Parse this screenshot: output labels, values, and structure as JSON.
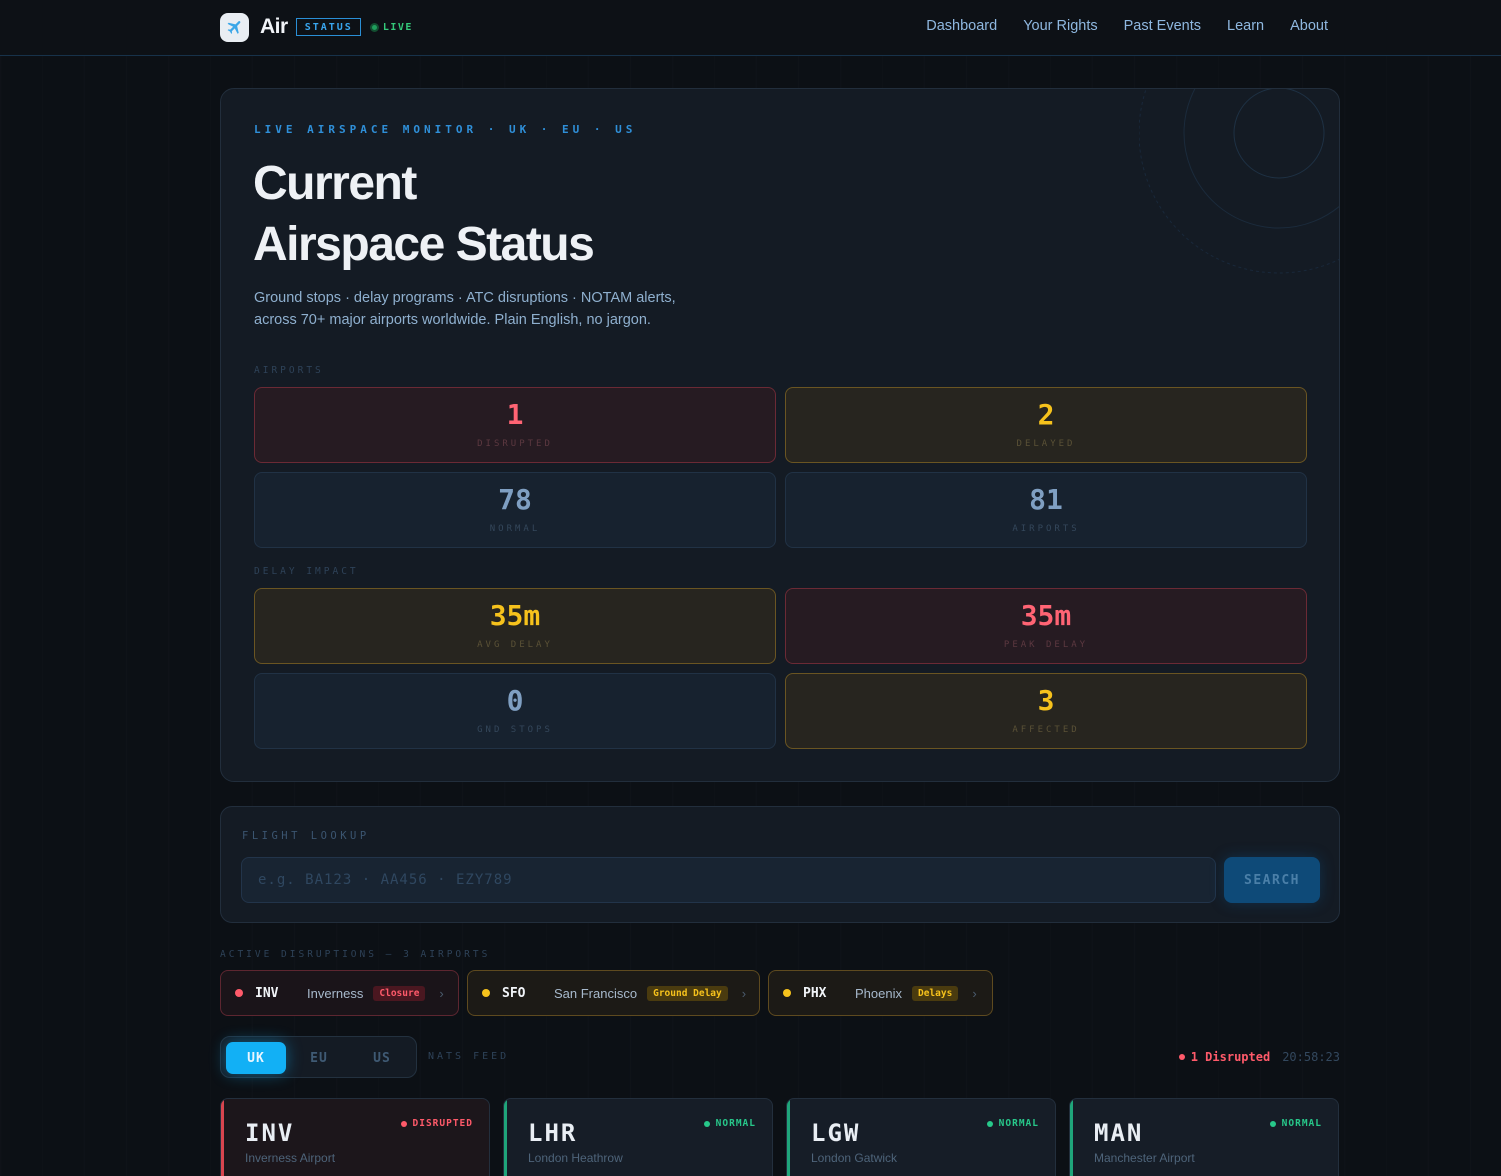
{
  "nav": {
    "brand": "Air",
    "status_tag": "STATUS",
    "live_label": "LIVE",
    "links": [
      "Dashboard",
      "Your Rights",
      "Past Events",
      "Learn",
      "About"
    ]
  },
  "hero": {
    "kicker": "LIVE AIRSPACE MONITOR · UK · EU · US",
    "title_line1": "Current",
    "title_line2": "Airspace Status",
    "subtitle": "Ground stops · delay programs · ATC disruptions · NOTAM alerts, across 70+ major airports worldwide. Plain English, no jargon.",
    "airports_label": "AIRPORTS",
    "airports": [
      {
        "value": "1",
        "label": "DISRUPTED",
        "tone": "red"
      },
      {
        "value": "2",
        "label": "DELAYED",
        "tone": "amber"
      },
      {
        "value": "78",
        "label": "NORMAL",
        "tone": "blue"
      },
      {
        "value": "81",
        "label": "AIRPORTS",
        "tone": "blue"
      }
    ],
    "delay_label": "DELAY IMPACT",
    "delay": [
      {
        "value": "35m",
        "label": "AVG DELAY",
        "tone": "amber"
      },
      {
        "value": "35m",
        "label": "PEAK DELAY",
        "tone": "red"
      },
      {
        "value": "0",
        "label": "GND STOPS",
        "tone": "blue"
      },
      {
        "value": "3",
        "label": "AFFECTED",
        "tone": "amber"
      }
    ]
  },
  "lookup": {
    "label": "FLIGHT LOOKUP",
    "placeholder": "e.g. BA123 · AA456 · EZY789",
    "value": "",
    "button": "SEARCH"
  },
  "disruptions": {
    "label": "ACTIVE DISRUPTIONS — 3 AIRPORTS",
    "items": [
      {
        "code": "INV",
        "city": "Inverness",
        "badge": "Closure",
        "tone": "red"
      },
      {
        "code": "SFO",
        "city": "San Francisco",
        "badge": "Ground Delay",
        "tone": "amber"
      },
      {
        "code": "PHX",
        "city": "Phoenix",
        "badge": "Delays",
        "tone": "amber"
      }
    ]
  },
  "regions": {
    "tabs": [
      "UK",
      "EU",
      "US"
    ],
    "active": "UK",
    "feed_label": "NATS FEED",
    "summary": "1 Disrupted",
    "time": "20:58:23"
  },
  "cards": [
    {
      "code": "INV",
      "name": "Inverness Airport",
      "status": "DISRUPTED",
      "tone": "red"
    },
    {
      "code": "LHR",
      "name": "London Heathrow",
      "status": "NORMAL",
      "tone": "green"
    },
    {
      "code": "LGW",
      "name": "London Gatwick",
      "status": "NORMAL",
      "tone": "green"
    },
    {
      "code": "MAN",
      "name": "Manchester Airport",
      "status": "NORMAL",
      "tone": "green"
    }
  ],
  "colors": {
    "accent": "#12b0f5",
    "disrupted": "#ff5a6a",
    "delayed": "#f6c21c",
    "normal": "#27c88a"
  }
}
